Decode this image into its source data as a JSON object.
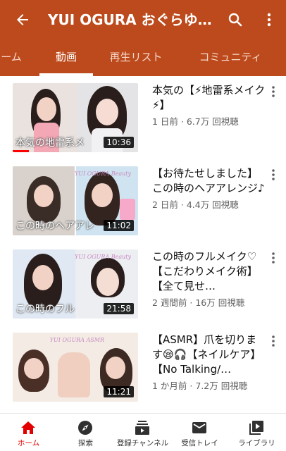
{
  "header": {
    "title": "YUI OGURA おぐらゆ…",
    "icons": {
      "back": "back-arrow-icon",
      "search": "search-icon",
      "more": "more-vert-icon"
    },
    "background_color": "#bd4a1c"
  },
  "tabs": [
    {
      "label": "ーム",
      "active": false
    },
    {
      "label": "動画",
      "active": true
    },
    {
      "label": "再生リスト",
      "active": false
    },
    {
      "label": "コミュニティ",
      "active": false
    }
  ],
  "videos": [
    {
      "title": "本気の【⚡地雷系メイク⚡】",
      "stats": "1 日前 · 6.7万 回視聴",
      "duration": "10:36",
      "thumb_text": "本気の地雷系メ",
      "thumb_logo": "",
      "watched_fraction": 0.13
    },
    {
      "title": "【お待たせしました】この時のヘアアレンジ♪",
      "stats": "2 日前 · 4.4万 回視聴",
      "duration": "11:02",
      "thumb_text": "この時のヘアアレ",
      "thumb_logo": "YUI OGURA Beauty",
      "watched_fraction": 0
    },
    {
      "title": "この時のフルメイク♡【こだわりメイク術】【全て見せ…",
      "stats": "2 週間前 · 16万 回視聴",
      "duration": "21:58",
      "thumb_text": "この時のフル",
      "thumb_logo": "YUI OGURA Beauty",
      "watched_fraction": 0
    },
    {
      "title": "【ASMR】爪を切ります😪🎧【ネイルケア】【No Talking/…",
      "stats": "1 か月前 · 7.2万 回視聴",
      "duration": "11:21",
      "thumb_text": "",
      "thumb_logo": "YUI OGURA ASMR",
      "watched_fraction": 0
    }
  ],
  "bottom_nav": [
    {
      "label": "ホーム",
      "icon": "home-icon",
      "active": true
    },
    {
      "label": "探索",
      "icon": "explore-icon",
      "active": false
    },
    {
      "label": "登録チャンネル",
      "icon": "subscriptions-icon",
      "active": false
    },
    {
      "label": "受信トレイ",
      "icon": "inbox-icon",
      "active": false
    },
    {
      "label": "ライブラリ",
      "icon": "library-icon",
      "active": false
    }
  ],
  "colors": {
    "accent": "#e20000",
    "progress": "#ff0000",
    "meta_text": "#606060"
  }
}
